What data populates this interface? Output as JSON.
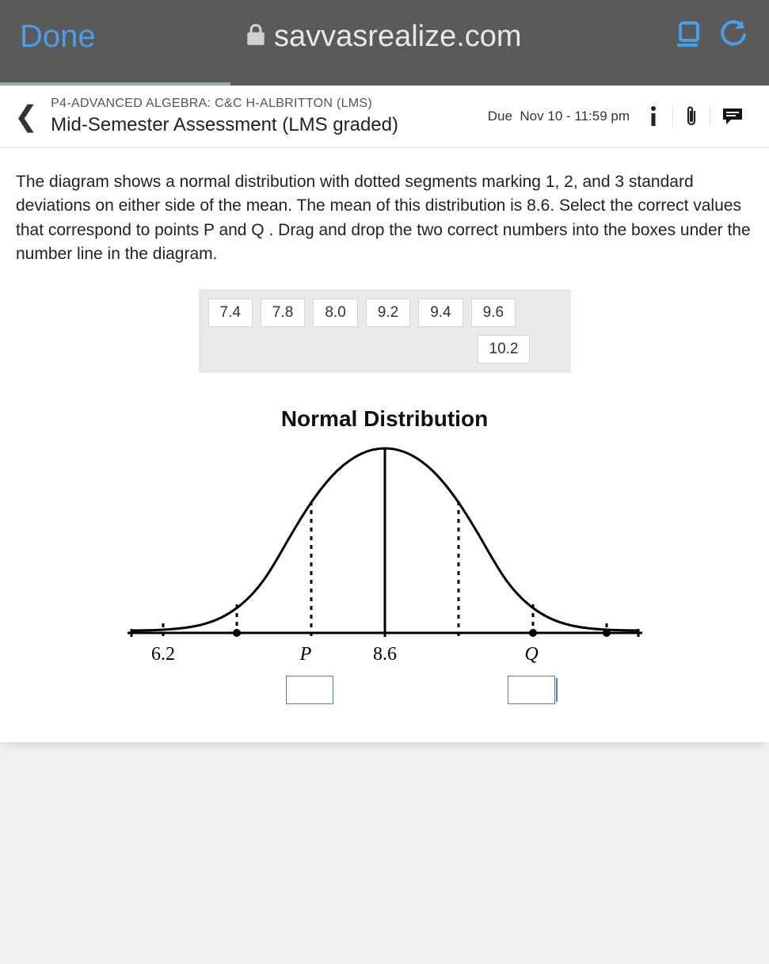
{
  "browser": {
    "done_label": "Done",
    "url": "savvasrealize.com",
    "progress_pct": 30
  },
  "header": {
    "course": "P4-ADVANCED ALGEBRA: C&C H-ALBRITTON (LMS)",
    "assessment": "Mid-Semester Assessment (LMS graded)",
    "due_prefix": "Due",
    "due_value": "Nov 10 - 11:59 pm"
  },
  "question": {
    "prompt": "The diagram shows a normal distribution with dotted segments marking 1, 2, and 3 standard deviations on either side of the mean. The mean of this distribution is 8.6. Select the correct values that correspond to points P and Q . Drag and drop the two correct numbers into the boxes under the number line in the diagram.",
    "choices": [
      "7.4",
      "7.8",
      "8.0",
      "9.2",
      "9.4",
      "9.6",
      "10.2"
    ]
  },
  "figure": {
    "title": "Normal Distribution",
    "axis_labels": {
      "left_3sd": "6.2",
      "p": "P",
      "mean": "8.6",
      "q": "Q"
    }
  },
  "chart_data": {
    "type": "line",
    "title": "Normal Distribution",
    "xlabel": "",
    "ylabel": "",
    "x_ticks": [
      6.2,
      7.0,
      7.8,
      8.6,
      9.4,
      10.2,
      11.0
    ],
    "x_tick_labels_shown": {
      "6.2": "6.2",
      "7.8": "P",
      "8.6": "8.6",
      "10.2": "Q"
    },
    "mean": 8.6,
    "sd": 0.8,
    "dashed_verticals_at": [
      6.2,
      7.0,
      7.8,
      9.4,
      10.2,
      11.0
    ],
    "solid_vertical_at": 8.6,
    "drop_targets": [
      "P",
      "Q"
    ]
  }
}
